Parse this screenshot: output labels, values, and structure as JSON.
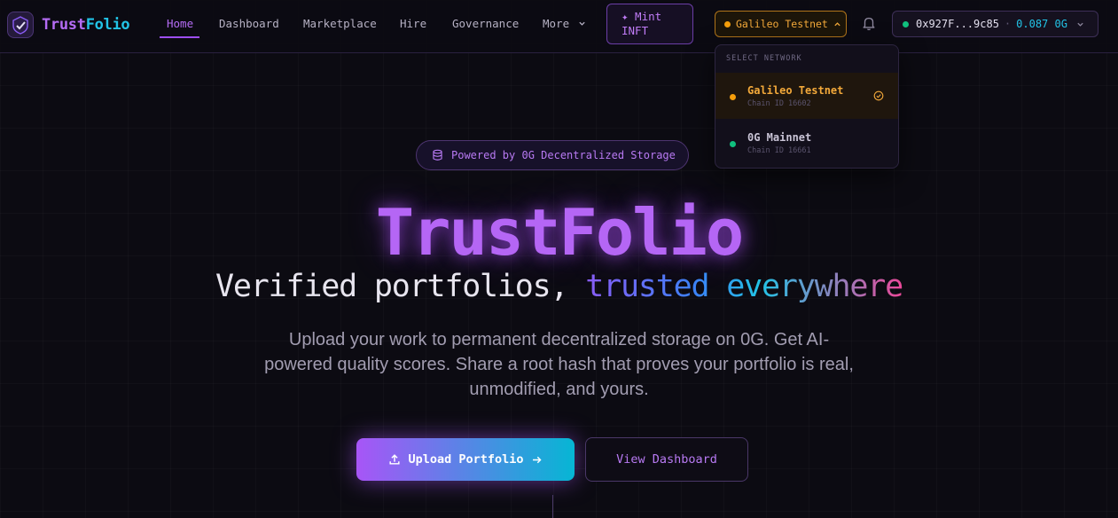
{
  "brand": {
    "name_part1": "Trust",
    "name_part2": "Folio"
  },
  "nav": {
    "links": [
      "Home",
      "Dashboard",
      "Marketplace",
      "Hire",
      "Governance",
      "More"
    ],
    "mint_label_line1": "✦ Mint",
    "mint_label_line2": "INFT"
  },
  "network": {
    "current": "Galileo Testnet",
    "dropdown": {
      "heading": "SELECT NETWORK",
      "items": [
        {
          "name": "Galileo Testnet",
          "chain": "Chain ID 16602",
          "selected": true,
          "color": "#f59e0b"
        },
        {
          "name": "0G Mainnet",
          "chain": "Chain ID 16661",
          "selected": false,
          "color": "#10c07e"
        }
      ]
    }
  },
  "wallet": {
    "address": "0x927F...9c85",
    "separator": "·",
    "balance": "0.087 0G"
  },
  "hero": {
    "badge": "Powered by 0G Decentralized Storage",
    "title": "TrustFolio",
    "subtitle_plain": "Verified portfolios, ",
    "subtitle_word1": "trusted",
    "subtitle_word2": "everywhere",
    "description": "Upload your work to permanent decentralized storage on 0G. Get AI-powered quality scores. Share a root hash that proves your portfolio is real, unmodified, and yours.",
    "primary_button": "Upload Portfolio",
    "secondary_button": "View Dashboard"
  },
  "colors": {
    "accent_purple": "#b566f5",
    "accent_cyan": "#22c3e6",
    "network_orange": "#f59e0b",
    "online_green": "#10c07e",
    "background": "#0c0b12"
  },
  "icons": [
    "logo-mark-icon",
    "chevron-down-icon",
    "chevron-up-icon",
    "bell-icon",
    "check-circle-icon",
    "database-icon",
    "upload-icon",
    "arrow-right-icon"
  ]
}
